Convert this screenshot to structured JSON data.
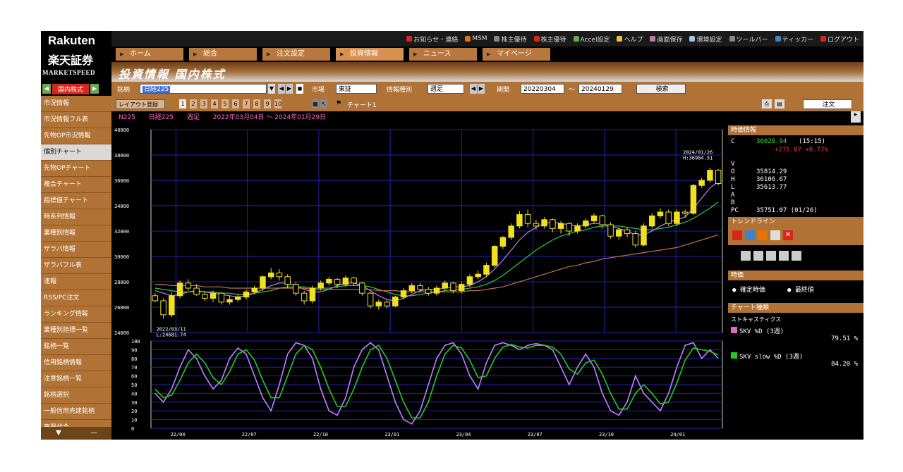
{
  "brand": {
    "name": "Rakuten",
    "sub": "楽天証券",
    "product": "MARKETSPEED"
  },
  "topmenu": [
    {
      "label": "お知らせ・連絡",
      "color": "#d9261c"
    },
    {
      "label": "MSM",
      "color": "#e8710a"
    },
    {
      "label": "株主優待",
      "color": "#888888"
    },
    {
      "label": "株主優待",
      "color": "#d9261c"
    },
    {
      "label": "Accel設定",
      "color": "#6aa84f"
    },
    {
      "label": "ヘルプ",
      "color": "#f1c232"
    },
    {
      "label": "画面保存",
      "color": "#c27ba0"
    },
    {
      "label": "環境設定",
      "color": "#9fc5e8"
    },
    {
      "label": "ツールバー",
      "color": "#888888"
    },
    {
      "label": "ティッカー",
      "color": "#3d85c6"
    },
    {
      "label": "ログアウト",
      "color": "#d9261c"
    }
  ],
  "tabs": [
    "ホーム",
    "総合",
    "注文設定",
    "投資情報",
    "ニュース",
    "マイページ"
  ],
  "active_tab": 3,
  "title": "投資情報 国内株式",
  "sidebar": {
    "selector_label": "国内株式",
    "items": [
      "市況情報",
      "市況情報フル表",
      "先物OP市況情報",
      "個別チャート",
      "先物OPチャート",
      "複合チャート",
      "指標値チャート",
      "時系列情報",
      "業種別情報",
      "ザラバ情報",
      "ザラバフル表",
      "速報",
      "RSS/PC注文",
      "ランキング情報",
      "業種別指標一覧",
      "銘柄一覧",
      "信用銘柄情報",
      "注意銘柄一覧",
      "銘柄選択",
      "一般信用売建銘柄",
      "売買代金"
    ],
    "active_index": 3
  },
  "search": {
    "label_symbol": "銘柄",
    "symbol_value": "日経225",
    "label_market": "市場",
    "market_value": "東証",
    "label_type": "情報種別",
    "type_value": "週足",
    "label_period": "期間",
    "date_from": "20220304",
    "date_sep": "〜",
    "date_to": "20240129",
    "search_button": "検索"
  },
  "chartbar": {
    "layout_label": "レイアウト登録",
    "numbers": [
      "1",
      "2",
      "3",
      "4",
      "5",
      "6",
      "7",
      "8",
      "9",
      "10"
    ],
    "chart_label": "チャート1",
    "order_button": "注文"
  },
  "info": {
    "code": "N225",
    "name": "日経225",
    "period_type": "週足",
    "range": "2022年03月04日 〜 2024年01月29日"
  },
  "chart_data": [
    {
      "type": "candlestick",
      "yticks": [
        "40000",
        "38000",
        "36000",
        "34000",
        "32000",
        "30000",
        "28000",
        "26000",
        "24000"
      ],
      "ylim": [
        24000,
        40000
      ],
      "annotations": [
        "2022/03/11\n L:24681.74",
        "2024/01/26\n H:36984.51"
      ],
      "candles": [
        [
          26900,
          26500,
          27100,
          26400
        ],
        [
          26500,
          25400,
          26700,
          25100
        ],
        [
          25400,
          26900,
          27200,
          25200
        ],
        [
          26900,
          27900,
          28100,
          26700
        ],
        [
          27900,
          27500,
          28200,
          27300
        ],
        [
          27500,
          27000,
          27800,
          26900
        ],
        [
          27000,
          26700,
          27300,
          26500
        ],
        [
          26700,
          27100,
          27300,
          26400
        ],
        [
          27100,
          26400,
          27200,
          26200
        ],
        [
          26400,
          26600,
          26900,
          26200
        ],
        [
          26600,
          26800,
          27000,
          26400
        ],
        [
          26800,
          27200,
          27400,
          26600
        ],
        [
          27200,
          27500,
          27700,
          27000
        ],
        [
          27500,
          28400,
          28500,
          27300
        ],
        [
          28400,
          28700,
          29100,
          28200
        ],
        [
          28700,
          28400,
          29000,
          28100
        ],
        [
          28400,
          27800,
          28600,
          27500
        ],
        [
          27800,
          27100,
          28000,
          26900
        ],
        [
          27100,
          26500,
          27300,
          26200
        ],
        [
          26500,
          27500,
          27700,
          26300
        ],
        [
          27500,
          27900,
          28100,
          27300
        ],
        [
          27900,
          28200,
          28400,
          27700
        ],
        [
          28200,
          27800,
          28300,
          27500
        ],
        [
          27800,
          28300,
          28500,
          27600
        ],
        [
          28300,
          27900,
          28400,
          27700
        ],
        [
          27900,
          27100,
          28000,
          26900
        ],
        [
          27100,
          26100,
          27200,
          25900
        ],
        [
          26100,
          26400,
          26600,
          25800
        ],
        [
          26400,
          26100,
          26600,
          25900
        ],
        [
          26100,
          26800,
          26900,
          26000
        ],
        [
          26800,
          27300,
          27500,
          26600
        ],
        [
          27300,
          27700,
          27900,
          27100
        ],
        [
          27700,
          27400,
          27900,
          27200
        ],
        [
          27400,
          27100,
          27600,
          26900
        ],
        [
          27100,
          27500,
          27700,
          26900
        ],
        [
          27500,
          27900,
          28100,
          27300
        ],
        [
          27900,
          27300,
          28000,
          27100
        ],
        [
          27300,
          27800,
          28000,
          27100
        ],
        [
          27800,
          28400,
          28600,
          27600
        ],
        [
          28400,
          28600,
          28900,
          28200
        ],
        [
          28600,
          29300,
          29500,
          28400
        ],
        [
          29300,
          30800,
          30900,
          29100
        ],
        [
          30800,
          31500,
          31600,
          30600
        ],
        [
          31500,
          32400,
          32600,
          31300
        ],
        [
          32400,
          33300,
          33600,
          32200
        ],
        [
          33300,
          32600,
          33700,
          32300
        ],
        [
          32600,
          32400,
          32900,
          32100
        ],
        [
          32400,
          32900,
          33100,
          32200
        ],
        [
          32900,
          32200,
          33000,
          31900
        ],
        [
          32200,
          32600,
          32800,
          31800
        ],
        [
          32600,
          32000,
          32700,
          31600
        ],
        [
          32000,
          32400,
          32600,
          31800
        ],
        [
          32400,
          32800,
          33000,
          32200
        ],
        [
          32800,
          33200,
          33400,
          32600
        ],
        [
          33200,
          32500,
          33300,
          32200
        ],
        [
          32500,
          31600,
          32700,
          31400
        ],
        [
          31600,
          32100,
          32300,
          31300
        ],
        [
          32100,
          31800,
          32300,
          31500
        ],
        [
          31800,
          30900,
          32000,
          30700
        ],
        [
          30900,
          32400,
          32600,
          30800
        ],
        [
          32400,
          33200,
          33400,
          32200
        ],
        [
          33200,
          33500,
          33800,
          33000
        ],
        [
          33500,
          32600,
          33700,
          32400
        ],
        [
          32600,
          33500,
          33700,
          32400
        ],
        [
          33500,
          33400,
          33700,
          33100
        ],
        [
          33400,
          35600,
          35700,
          33300
        ],
        [
          35600,
          36000,
          36200,
          35400
        ],
        [
          36000,
          36800,
          36984,
          35800
        ],
        [
          36800,
          35751,
          36900,
          35600
        ]
      ],
      "ma": [
        {
          "name": "MA short",
          "color": "#c080ff",
          "values": [
            27300,
            27100,
            26900,
            27000,
            27200,
            27300,
            27200,
            27100,
            27000,
            26900,
            26800,
            26900,
            27100,
            27400,
            27700,
            27900,
            27900,
            27700,
            27400,
            27200,
            27200,
            27400,
            27700,
            27900,
            27900,
            27700,
            27300,
            26900,
            26600,
            26500,
            26700,
            27000,
            27300,
            27400,
            27400,
            27500,
            27600,
            27600,
            27700,
            28000,
            28400,
            29000,
            29700,
            30500,
            31300,
            31900,
            32300,
            32600,
            32700,
            32600,
            32500,
            32400,
            32500,
            32600,
            32600,
            32400,
            32200,
            32000,
            31700,
            31700,
            32000,
            32400,
            32700,
            32900,
            33100,
            33800,
            34600,
            35400,
            35900
          ]
        },
        {
          "name": "MA mid",
          "color": "#33cc33",
          "values": [
            27500,
            27400,
            27300,
            27200,
            27200,
            27200,
            27200,
            27200,
            27100,
            27100,
            27000,
            27000,
            27100,
            27200,
            27300,
            27500,
            27600,
            27600,
            27600,
            27500,
            27500,
            27500,
            27600,
            27700,
            27700,
            27700,
            27600,
            27400,
            27200,
            27000,
            26900,
            26900,
            27000,
            27100,
            27200,
            27300,
            27400,
            27400,
            27500,
            27600,
            27800,
            28100,
            28500,
            29000,
            29500,
            30000,
            30500,
            30900,
            31300,
            31600,
            31800,
            32000,
            32100,
            32300,
            32400,
            32400,
            32400,
            32300,
            32200,
            32100,
            32100,
            32200,
            32300,
            32500,
            32700,
            33000,
            33400,
            33800,
            34300
          ]
        },
        {
          "name": "MA long",
          "color": "#c8705a",
          "values": [
            27800,
            27800,
            27700,
            27700,
            27700,
            27700,
            27600,
            27600,
            27600,
            27500,
            27500,
            27500,
            27500,
            27500,
            27500,
            27500,
            27500,
            27500,
            27500,
            27400,
            27400,
            27400,
            27400,
            27400,
            27400,
            27400,
            27400,
            27300,
            27300,
            27300,
            27200,
            27200,
            27200,
            27200,
            27200,
            27200,
            27200,
            27200,
            27300,
            27300,
            27400,
            27500,
            27600,
            27800,
            28000,
            28200,
            28400,
            28600,
            28800,
            29000,
            29200,
            29300,
            29500,
            29600,
            29800,
            29900,
            30000,
            30100,
            30200,
            30300,
            30400,
            30500,
            30600,
            30700,
            30900,
            31100,
            31300,
            31500,
            31700
          ]
        }
      ]
    },
    {
      "type": "line",
      "name": "stochastics",
      "yticks": [
        "100",
        "90",
        "80",
        "70",
        "60",
        "50",
        "40",
        "30",
        "20",
        "10",
        "0"
      ],
      "ylim": [
        0,
        100
      ],
      "xticks": [
        "22/04",
        "22/07",
        "22/10",
        "23/01",
        "23/04",
        "23/07",
        "23/10",
        "24/01"
      ],
      "series": [
        {
          "name": "SKV %D (3週)",
          "color": "#c080ff",
          "values": [
            40,
            30,
            45,
            70,
            90,
            80,
            60,
            45,
            55,
            80,
            92,
            85,
            60,
            35,
            20,
            50,
            85,
            98,
            95,
            80,
            45,
            20,
            15,
            35,
            70,
            90,
            98,
            90,
            60,
            30,
            10,
            5,
            20,
            50,
            80,
            95,
            98,
            85,
            60,
            45,
            75,
            95,
            98,
            95,
            90,
            95,
            97,
            95,
            90,
            70,
            50,
            70,
            85,
            70,
            40,
            20,
            15,
            30,
            60,
            40,
            30,
            20,
            40,
            70,
            95,
            98,
            80,
            90,
            80
          ]
        },
        {
          "name": "SKV slow %D (3週)",
          "color": "#22cc22",
          "values": [
            45,
            35,
            38,
            55,
            75,
            85,
            75,
            58,
            50,
            65,
            85,
            90,
            78,
            55,
            35,
            35,
            60,
            85,
            95,
            90,
            70,
            45,
            25,
            25,
            45,
            70,
            90,
            95,
            80,
            55,
            30,
            12,
            12,
            30,
            60,
            85,
            95,
            92,
            78,
            58,
            60,
            80,
            93,
            96,
            93,
            92,
            95,
            95,
            93,
            85,
            68,
            62,
            75,
            78,
            62,
            40,
            22,
            22,
            40,
            50,
            40,
            28,
            30,
            52,
            78,
            92,
            90,
            88,
            84
          ]
        }
      ]
    }
  ],
  "right_panel": {
    "quote_header": "時価情報",
    "c_label": "C",
    "c_value": "36026.94",
    "c_time": "(15:15)",
    "change": "+275.87 +0.77%",
    "rows": [
      {
        "k": "V",
        "v": ""
      },
      {
        "k": "O",
        "v": "35814.29"
      },
      {
        "k": "H",
        "v": "36106.67"
      },
      {
        "k": "L",
        "v": "35613.77"
      },
      {
        "k": "A",
        "v": ""
      },
      {
        "k": "B",
        "v": ""
      },
      {
        "k": "PC",
        "v": "35751.07 (01/26)"
      }
    ],
    "trendline_header": "トレンドライン",
    "price_header": "時価",
    "radio1": "確定時価",
    "radio2": "最終値",
    "chart_type_header": "チャート種類",
    "chart_type_value": "ストキャスティクス",
    "legend": [
      {
        "label": "SKV %D (3週)",
        "value": "79.51 %",
        "color": "#e066cc"
      },
      {
        "label": "SKV slow %D (3週)",
        "value": "84.20 %",
        "color": "#22cc22"
      }
    ]
  }
}
